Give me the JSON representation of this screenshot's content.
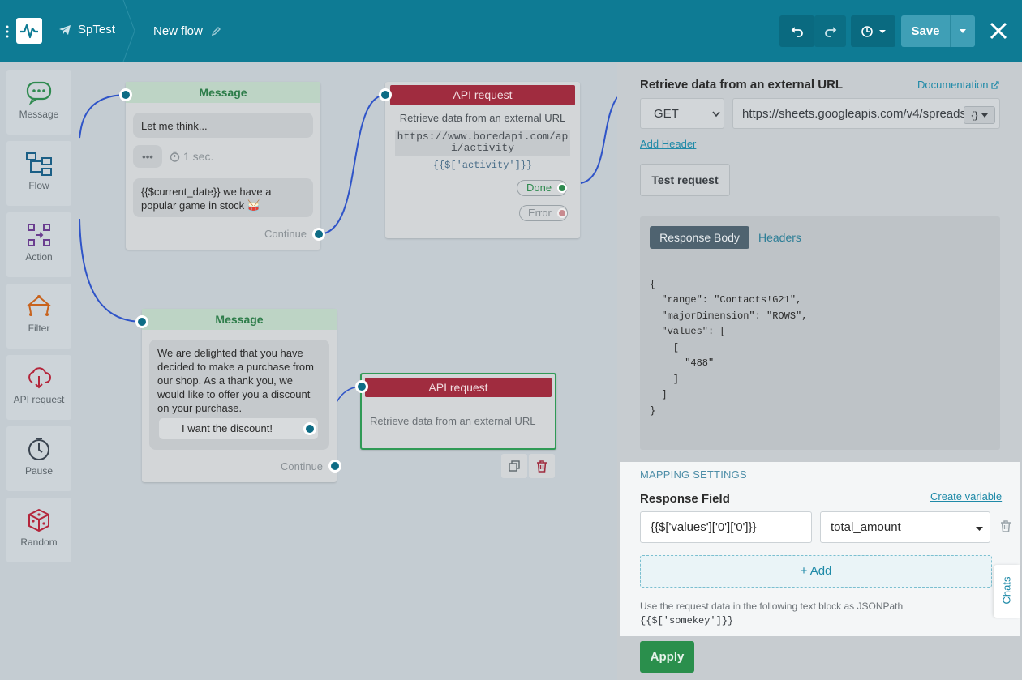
{
  "header": {
    "bot_name": "SpTest",
    "flow_name": "New flow",
    "save_label": "Save",
    "colors": {
      "header_bg": "#0e7b94",
      "save_bg": "#3f9fb6",
      "accent": "#1f8aa8"
    }
  },
  "sidebar": {
    "items": [
      {
        "label": "Message",
        "icon": "message-icon"
      },
      {
        "label": "Flow",
        "icon": "flow-icon"
      },
      {
        "label": "Action",
        "icon": "action-icon"
      },
      {
        "label": "Filter",
        "icon": "filter-icon"
      },
      {
        "label": "API request",
        "icon": "api-request-icon"
      },
      {
        "label": "Pause",
        "icon": "pause-icon"
      },
      {
        "label": "Random",
        "icon": "random-icon"
      }
    ]
  },
  "canvas": {
    "message1": {
      "title": "Message",
      "text1": "Let me think...",
      "typing": "•••",
      "delay": "1 sec.",
      "text2_line1": "{{$current_date}}  we have a",
      "text2_line2": "popular game in stock 🥁",
      "continue": "Continue"
    },
    "api1": {
      "title": "API request",
      "subtitle": "Retrieve data from an external URL",
      "url_line1": "https://www.boredapi.com/ap",
      "url_line2": "i/activity",
      "path": "{{$['activity']}}",
      "done": "Done",
      "error": "Error"
    },
    "message2": {
      "title": "Message",
      "text_lines": [
        "We are delighted that you have",
        "decided to make a purchase from",
        "our shop. As a thank you, we",
        "would like to offer you a discount",
        "on your purchase."
      ],
      "button": "I want the discount!",
      "continue": "Continue"
    },
    "api2": {
      "title": "API request",
      "subtitle": "Retrieve data from an external URL"
    }
  },
  "panel": {
    "section_title": "Retrieve data from an external URL",
    "documentation": "Documentation",
    "method": "GET",
    "url": "https://sheets.googleapis.com/v4/spreads",
    "var_button": "{}",
    "add_header": "Add Header",
    "test_request": "Test request",
    "tabs": {
      "body": "Response Body",
      "headers": "Headers"
    },
    "response_lines": [
      "{",
      "  \"range\": \"Contacts!G21\",",
      "  \"majorDimension\": \"ROWS\",",
      "  \"values\": [",
      "    [",
      "      \"488\"",
      "    ]",
      "  ]",
      "}"
    ],
    "mapping": {
      "title": "MAPPING SETTINGS",
      "field_label": "Response Field",
      "create_variable": "Create variable",
      "field_value": "{{$['values']['0']['0']}}",
      "variable": "total_amount",
      "add": "+ Add",
      "hint": "Use the request data in the following text block as JSONPath",
      "hint_code": "{{$['somekey']}}"
    },
    "apply": "Apply",
    "chats_tab": "Chats"
  }
}
